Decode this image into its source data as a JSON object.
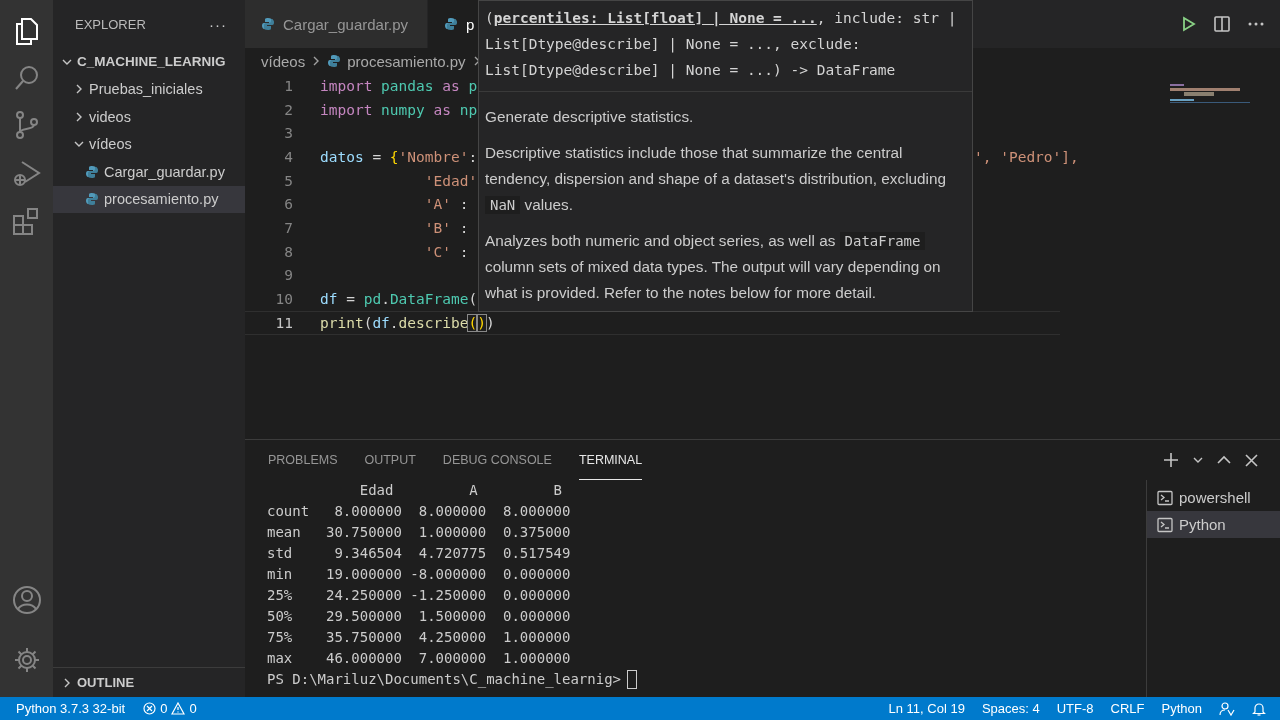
{
  "activity_bar": [
    {
      "kind": "files",
      "selected": true
    },
    {
      "kind": "search",
      "selected": false
    },
    {
      "kind": "source-control",
      "selected": false
    },
    {
      "kind": "run-debug",
      "selected": false
    },
    {
      "kind": "extensions",
      "selected": false
    }
  ],
  "sidebar": {
    "title": "EXPLORER",
    "more": "···",
    "tree": [
      {
        "label": "C_MACHINE_LEARNIG",
        "kind": "root",
        "expanded": true,
        "selected": false,
        "children": [
          {
            "label": "Pruebas_iniciales",
            "kind": "folder",
            "expanded": false,
            "selected": false
          },
          {
            "label": "videos",
            "kind": "folder",
            "expanded": false,
            "selected": false
          },
          {
            "label": "vídeos",
            "kind": "folder",
            "expanded": true,
            "selected": false,
            "children": [
              {
                "label": "Cargar_guardar.py",
                "kind": "file",
                "selected": false
              },
              {
                "label": "procesamiento.py",
                "kind": "file",
                "selected": true
              }
            ]
          }
        ]
      }
    ],
    "outline": {
      "label": "OUTLINE",
      "expanded": false
    }
  },
  "editor_tabs": [
    {
      "label": "Cargar_guardar.py",
      "selected": false
    },
    {
      "label": "p",
      "selected": true
    }
  ],
  "breadcrumb": [
    {
      "label": "vídeos",
      "kind": "folder"
    },
    {
      "label": "procesamiento.py",
      "kind": "file"
    }
  ],
  "code": [
    {
      "n": "1",
      "segs": [
        {
          "t": "import ",
          "kind": "keyword"
        },
        {
          "t": "pandas ",
          "kind": "module"
        },
        {
          "t": "as ",
          "kind": "keyword"
        },
        {
          "t": "p",
          "kind": "module"
        }
      ]
    },
    {
      "n": "2",
      "segs": [
        {
          "t": "import ",
          "kind": "keyword"
        },
        {
          "t": "numpy ",
          "kind": "module"
        },
        {
          "t": "as ",
          "kind": "keyword"
        },
        {
          "t": "np",
          "kind": "module"
        }
      ]
    },
    {
      "n": "3"
    },
    {
      "n": "4",
      "segs": [
        {
          "t": "datos",
          "kind": "variable"
        },
        {
          "t": " = ",
          "kind": "plain"
        },
        {
          "t": "{",
          "kind": "brace"
        },
        {
          "t": "'Nombre'",
          "kind": "string"
        },
        {
          "t": ":",
          "kind": "plain"
        },
        {
          "t": "', 'Pedro'],",
          "kind": "tail"
        }
      ]
    },
    {
      "n": "5",
      "continuation": true,
      "segs": [
        {
          "t": "'Edad'",
          "kind": "string"
        }
      ]
    },
    {
      "n": "6",
      "continuation": true,
      "segs": [
        {
          "t": "'A'",
          "kind": "string"
        },
        {
          "t": " :",
          "kind": "plain"
        }
      ]
    },
    {
      "n": "7",
      "continuation": true,
      "segs": [
        {
          "t": "'B'",
          "kind": "string"
        },
        {
          "t": " :",
          "kind": "plain"
        }
      ]
    },
    {
      "n": "8",
      "continuation": true,
      "segs": [
        {
          "t": "'C'",
          "kind": "string"
        },
        {
          "t": " :",
          "kind": "plain"
        }
      ]
    },
    {
      "n": "9"
    },
    {
      "n": "10",
      "segs": [
        {
          "t": "df",
          "kind": "variable"
        },
        {
          "t": " = ",
          "kind": "plain"
        },
        {
          "t": "pd",
          "kind": "module"
        },
        {
          "t": ".",
          "kind": "plain"
        },
        {
          "t": "DataFrame",
          "kind": "module"
        },
        {
          "t": "(",
          "kind": "plain"
        }
      ]
    },
    {
      "n": "11",
      "current": true,
      "segs": [
        {
          "t": "print",
          "kind": "function"
        },
        {
          "t": "(",
          "kind": "plain"
        },
        {
          "t": "df",
          "kind": "variable"
        },
        {
          "t": ".",
          "kind": "plain"
        },
        {
          "t": "describe",
          "kind": "function"
        },
        {
          "t": "(",
          "kind": "match"
        },
        {
          "t": ")",
          "kind": "match"
        },
        {
          "t": ")",
          "kind": "plain"
        }
      ]
    }
  ],
  "hover": {
    "signature": [
      {
        "t": "(",
        "kind": "plain"
      },
      {
        "t": "percentiles: List[float] | None = ...",
        "kind": "active"
      },
      {
        "t": ", include: str | List[Dtype@describe] | None = ..., exclude: List[Dtype@describe] | None = ...) -> DataFrame",
        "kind": "plain"
      }
    ],
    "paragraphs": [
      [
        {
          "t": "Generate descriptive statistics.",
          "kind": "text"
        }
      ],
      [
        {
          "t": "Descriptive statistics include those that summarize the central tendency, dispersion and shape of a dataset's distribution, excluding ",
          "kind": "text"
        },
        {
          "t": "NaN",
          "kind": "code"
        },
        {
          "t": " values.",
          "kind": "text"
        }
      ],
      [
        {
          "t": "Analyzes both numeric and object series, as well as ",
          "kind": "text"
        },
        {
          "t": "DataFrame",
          "kind": "code"
        },
        {
          "t": " column sets of mixed data types. The output will vary depending on what is provided. Refer to the notes below for more detail.",
          "kind": "text"
        }
      ]
    ]
  },
  "panel": {
    "tabs": [
      {
        "label": "PROBLEMS",
        "selected": false
      },
      {
        "label": "OUTPUT",
        "selected": false
      },
      {
        "label": "DEBUG CONSOLE",
        "selected": false
      },
      {
        "label": "TERMINAL",
        "selected": true
      }
    ],
    "terminal_lines": [
      "           Edad         A         B",
      "count   8.000000  8.000000  8.000000",
      "mean   30.750000  1.000000  0.375000",
      "std     9.346504  4.720775  0.517549",
      "min    19.000000 -8.000000  0.000000",
      "25%    24.250000 -1.250000  0.000000",
      "50%    29.500000  1.500000  0.000000",
      "75%    35.750000  4.250000  1.000000",
      "max    46.000000  7.000000  1.000000"
    ],
    "prompt": "PS D:\\Mariluz\\Documents\\C_machine_learnig>",
    "terminals": [
      {
        "label": "powershell",
        "selected": false
      },
      {
        "label": "Python",
        "selected": true
      }
    ]
  },
  "status_bar": {
    "interpreter": "Python 3.7.3 32-bit",
    "errors": "0",
    "warnings": "0",
    "right": [
      "Ln 11, Col 19",
      "Spaces: 4",
      "UTF-8",
      "CRLF",
      "Python"
    ]
  }
}
